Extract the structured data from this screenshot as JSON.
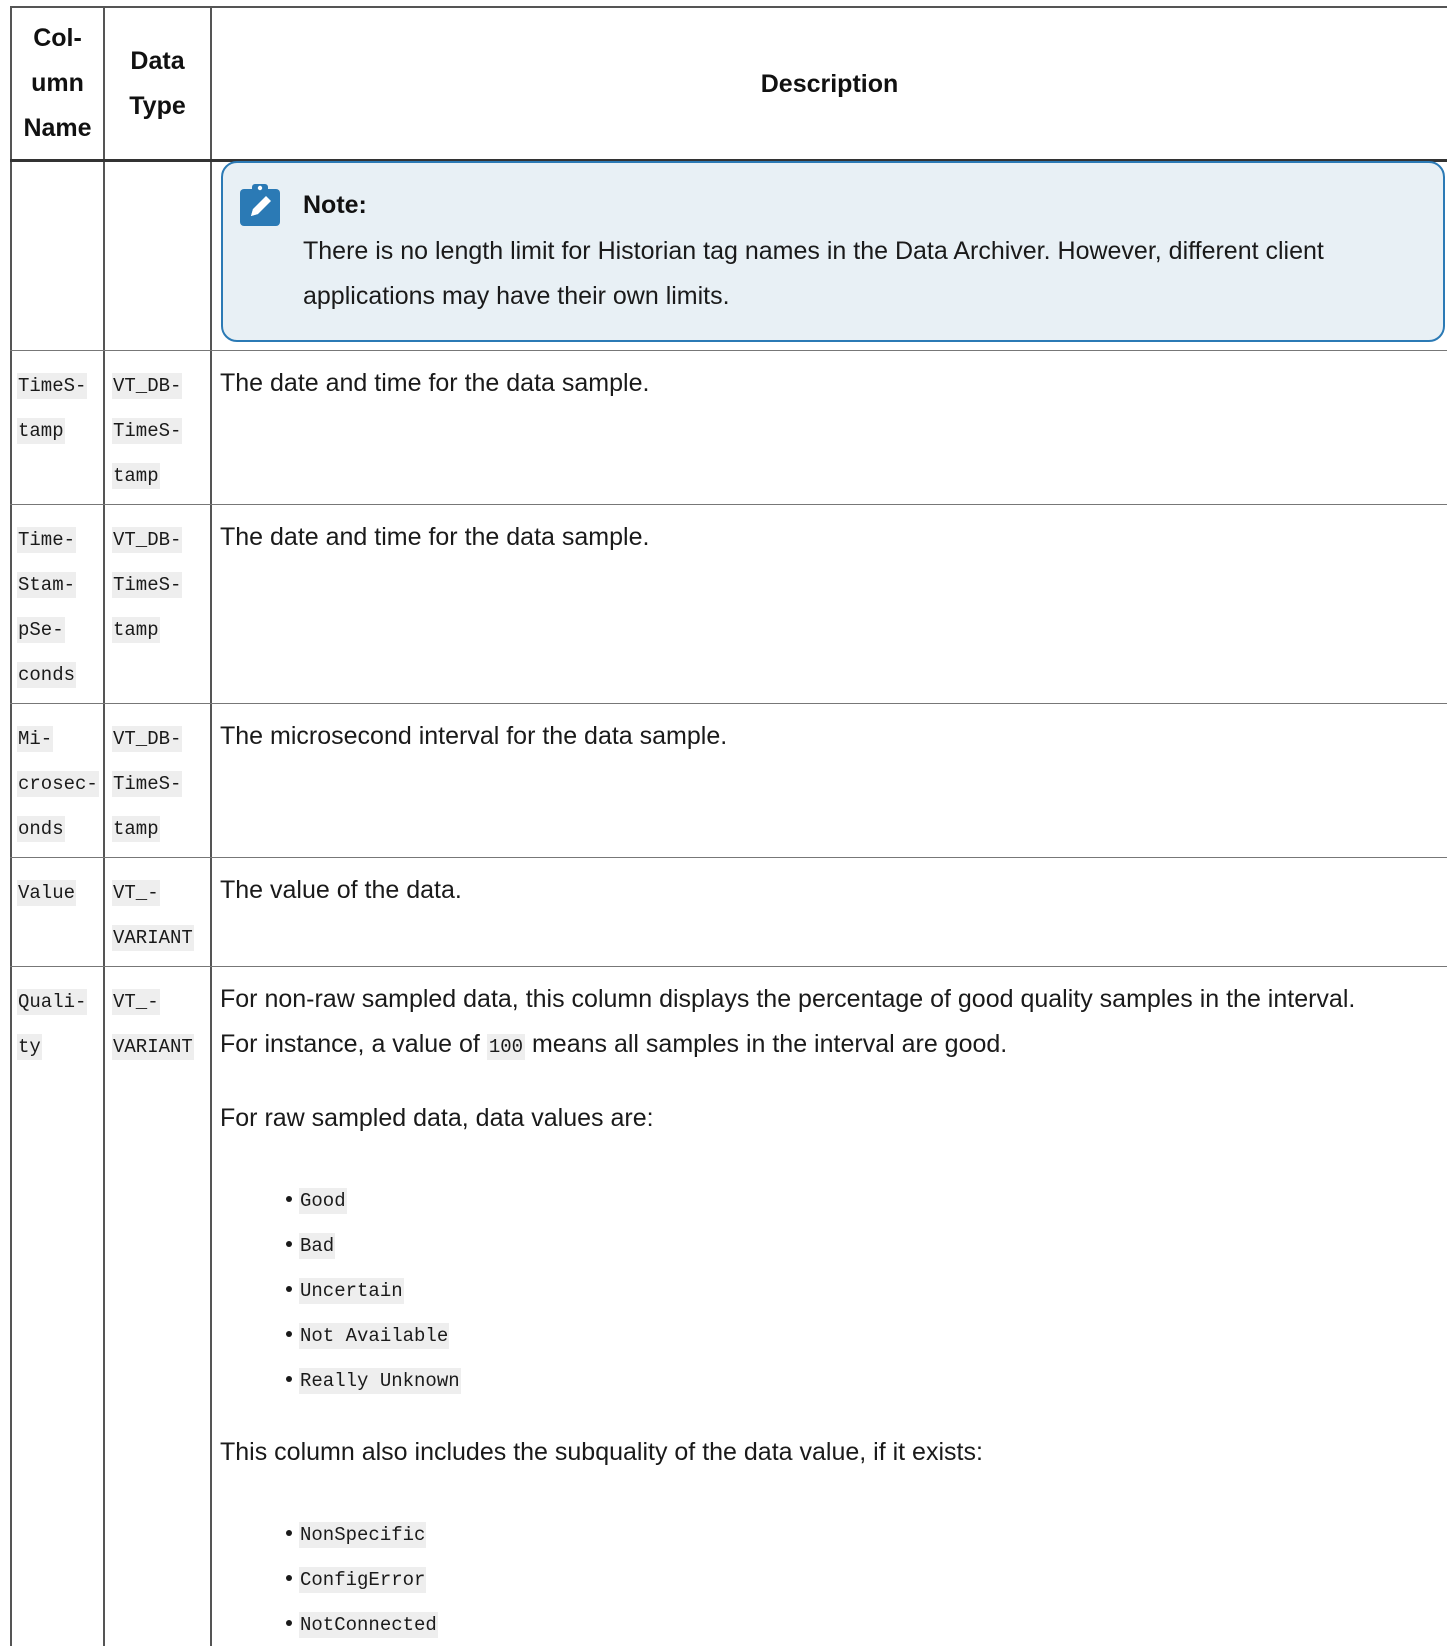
{
  "header": {
    "col1_lines": [
      "Col-",
      "umn",
      "Name"
    ],
    "col2_lines": [
      "Data",
      "Type"
    ],
    "col3": "Description"
  },
  "note": {
    "title": "Note:",
    "text": "There is no length limit for Historian tag names in the Data Archiver. However, different client applications may have their own limits."
  },
  "rows": [
    {
      "name_lines": [
        "TimeS-",
        "tamp"
      ],
      "type_lines": [
        "VT_DB-",
        "TimeS-",
        "tamp"
      ],
      "description": "The date and time for the data sample."
    },
    {
      "name_lines": [
        "Time-",
        "Stam-",
        "pSe-",
        "conds"
      ],
      "type_lines": [
        "VT_DB-",
        "TimeS-",
        "tamp"
      ],
      "description": "The date and time for the data sample."
    },
    {
      "name_lines": [
        "Mi-",
        "crosec-",
        "onds"
      ],
      "type_lines": [
        "VT_DB-",
        "TimeS-",
        "tamp"
      ],
      "description": "The microsecond interval for the data sample."
    },
    {
      "name_lines": [
        "Value"
      ],
      "type_lines": [
        "VT_-",
        "VARIANT"
      ],
      "description": "The value of the data."
    },
    {
      "name_lines": [
        "Quali-",
        "ty"
      ],
      "type_lines": [
        "VT_-",
        "VARIANT"
      ],
      "description_line1": "For non-raw sampled data, this column displays the percentage of good quality samples in the interval.",
      "description_line2_pre": "For instance, a value of ",
      "description_line2_code": "100",
      "description_line2_post": " means all samples in the interval are good.",
      "raw_intro": "For raw sampled data, data values are:",
      "raw_values": [
        "Good",
        "Bad",
        "Uncertain",
        "Not Available",
        "Really Unknown"
      ],
      "subquality_intro": "This column also includes the subquality of the data value, if it exists:",
      "subquality_values": [
        "NonSpecific",
        "ConfigError",
        "NotConnected"
      ]
    }
  ]
}
